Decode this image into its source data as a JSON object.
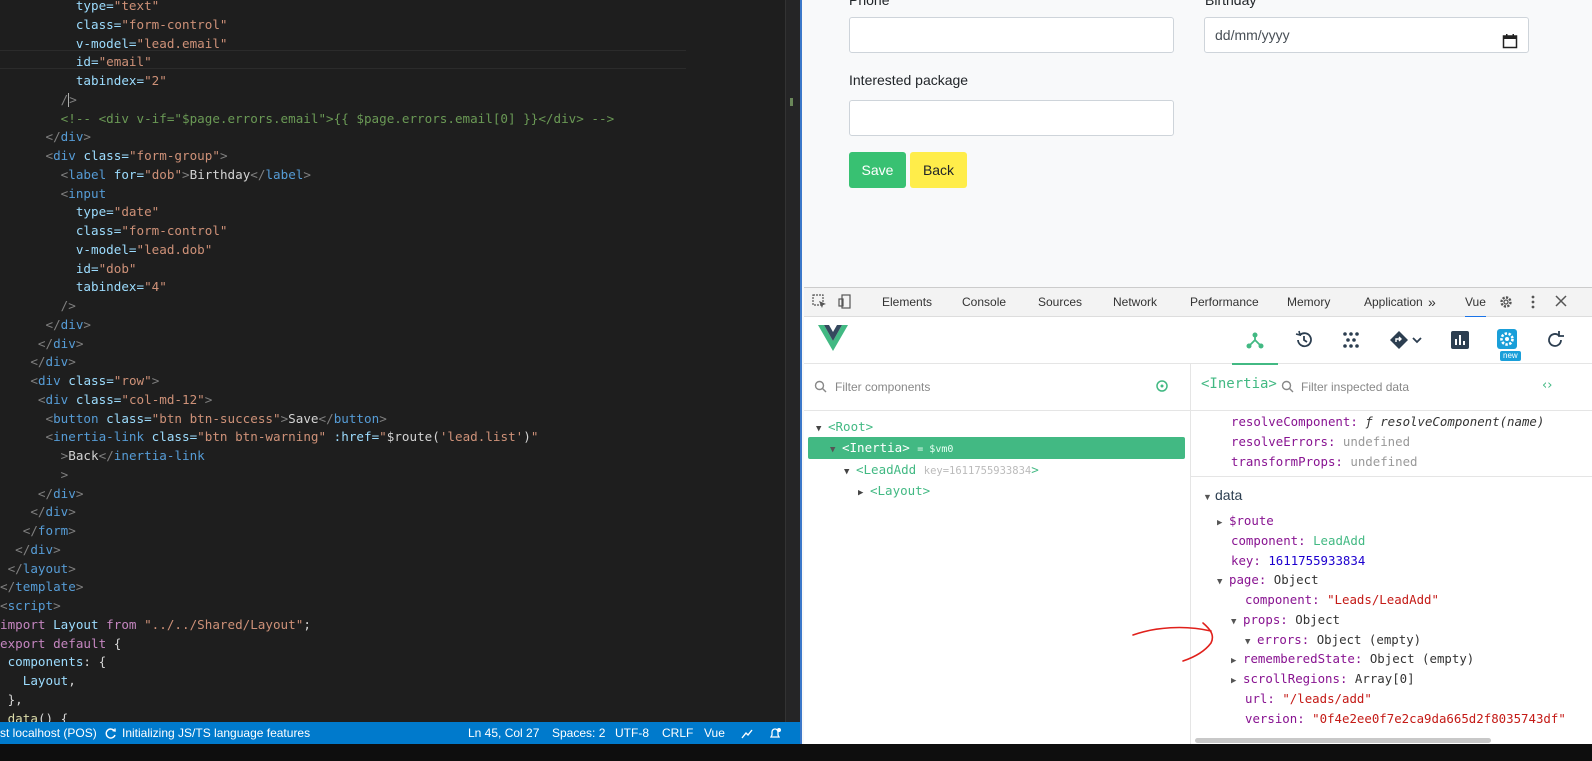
{
  "editor": {
    "lines": [
      [
        [
          "          ",
          "t-txt"
        ],
        [
          "type=",
          "t-attr"
        ],
        [
          "\"text\"",
          "t-str"
        ]
      ],
      [
        [
          "          ",
          "t-txt"
        ],
        [
          "class=",
          "t-attr"
        ],
        [
          "\"form-control\"",
          "t-str"
        ]
      ],
      [
        [
          "          ",
          "t-txt"
        ],
        [
          "v-model=",
          "t-attr"
        ],
        [
          "\"lead.email\"",
          "t-str"
        ]
      ],
      [
        [
          "          ",
          "t-txt"
        ],
        [
          "id=",
          "t-attr"
        ],
        [
          "\"email\"",
          "t-str"
        ]
      ],
      [
        [
          "          ",
          "t-txt"
        ],
        [
          "tabindex=",
          "t-attr"
        ],
        [
          "\"2\"",
          "t-str"
        ]
      ],
      [
        [
          "        ",
          "t-txt"
        ],
        [
          "/",
          "t-br"
        ],
        [
          "CURSOR",
          ""
        ],
        [
          ">",
          "t-br"
        ]
      ],
      [
        [
          "        ",
          "t-txt"
        ],
        [
          "<!-- <div v-if=\"$page.errors.email\">{{ $page.errors.email[0] }}</div> -->",
          "t-cmt"
        ]
      ],
      [
        [
          "      ",
          "t-txt"
        ],
        [
          "</",
          "t-br"
        ],
        [
          "div",
          "t-tag"
        ],
        [
          ">",
          "t-br"
        ]
      ],
      [
        [
          "      ",
          "t-txt"
        ],
        [
          "<",
          "t-br"
        ],
        [
          "div ",
          "t-tag"
        ],
        [
          "class=",
          "t-attr"
        ],
        [
          "\"form-group\"",
          "t-str"
        ],
        [
          ">",
          "t-br"
        ]
      ],
      [
        [
          "        ",
          "t-txt"
        ],
        [
          "<",
          "t-br"
        ],
        [
          "label ",
          "t-tag"
        ],
        [
          "for=",
          "t-attr"
        ],
        [
          "\"dob\"",
          "t-str"
        ],
        [
          ">",
          "t-br"
        ],
        [
          "Birthday",
          "t-txt"
        ],
        [
          "</",
          "t-br"
        ],
        [
          "label",
          "t-tag"
        ],
        [
          ">",
          "t-br"
        ]
      ],
      [
        [
          "        ",
          "t-txt"
        ],
        [
          "<",
          "t-br"
        ],
        [
          "input",
          "t-tag"
        ]
      ],
      [
        [
          "          ",
          "t-txt"
        ],
        [
          "type=",
          "t-attr"
        ],
        [
          "\"date\"",
          "t-str"
        ]
      ],
      [
        [
          "          ",
          "t-txt"
        ],
        [
          "class=",
          "t-attr"
        ],
        [
          "\"form-control\"",
          "t-str"
        ]
      ],
      [
        [
          "          ",
          "t-txt"
        ],
        [
          "v-model=",
          "t-attr"
        ],
        [
          "\"lead.dob\"",
          "t-str"
        ]
      ],
      [
        [
          "          ",
          "t-txt"
        ],
        [
          "id=",
          "t-attr"
        ],
        [
          "\"dob\"",
          "t-str"
        ]
      ],
      [
        [
          "          ",
          "t-txt"
        ],
        [
          "tabindex=",
          "t-attr"
        ],
        [
          "\"4\"",
          "t-str"
        ]
      ],
      [
        [
          "        ",
          "t-txt"
        ],
        [
          "/>",
          "t-br"
        ]
      ],
      [
        [
          "      ",
          "t-txt"
        ],
        [
          "</",
          "t-br"
        ],
        [
          "div",
          "t-tag"
        ],
        [
          ">",
          "t-br"
        ]
      ],
      [
        [
          "     ",
          "t-txt"
        ],
        [
          "</",
          "t-br"
        ],
        [
          "div",
          "t-tag"
        ],
        [
          ">",
          "t-br"
        ]
      ],
      [
        [
          "    ",
          "t-txt"
        ],
        [
          "</",
          "t-br"
        ],
        [
          "div",
          "t-tag"
        ],
        [
          ">",
          "t-br"
        ]
      ],
      [
        [
          "    ",
          "t-txt"
        ],
        [
          "<",
          "t-br"
        ],
        [
          "div ",
          "t-tag"
        ],
        [
          "class=",
          "t-attr"
        ],
        [
          "\"row\"",
          "t-str"
        ],
        [
          ">",
          "t-br"
        ]
      ],
      [
        [
          "     ",
          "t-txt"
        ],
        [
          "<",
          "t-br"
        ],
        [
          "div ",
          "t-tag"
        ],
        [
          "class=",
          "t-attr"
        ],
        [
          "\"col-md-12\"",
          "t-str"
        ],
        [
          ">",
          "t-br"
        ]
      ],
      [
        [
          "      ",
          "t-txt"
        ],
        [
          "<",
          "t-br"
        ],
        [
          "button ",
          "t-tag"
        ],
        [
          "class=",
          "t-attr"
        ],
        [
          "\"btn btn-success\"",
          "t-str"
        ],
        [
          ">",
          "t-br"
        ],
        [
          "Save",
          "t-txt"
        ],
        [
          "</",
          "t-br"
        ],
        [
          "button",
          "t-tag"
        ],
        [
          ">",
          "t-br"
        ]
      ],
      [
        [
          "      ",
          "t-txt"
        ],
        [
          "<",
          "t-br"
        ],
        [
          "inertia-link ",
          "t-tag"
        ],
        [
          "class=",
          "t-attr"
        ],
        [
          "\"btn btn-warning\"",
          "t-str"
        ],
        [
          " :href=",
          "t-attr"
        ],
        [
          "\"",
          "t-str"
        ],
        [
          "$route(",
          "t-txt"
        ],
        [
          "'lead.list'",
          "t-str"
        ],
        [
          ")",
          "t-txt"
        ],
        [
          "\"",
          "t-str"
        ]
      ],
      [
        [
          "        ",
          "t-txt"
        ],
        [
          ">",
          "t-br"
        ],
        [
          "Back",
          "t-txt"
        ],
        [
          "</",
          "t-br"
        ],
        [
          "inertia-link",
          "t-tag"
        ]
      ],
      [
        [
          "        ",
          "t-txt"
        ],
        [
          ">",
          "t-br"
        ]
      ],
      [
        [
          "     ",
          "t-txt"
        ],
        [
          "</",
          "t-br"
        ],
        [
          "div",
          "t-tag"
        ],
        [
          ">",
          "t-br"
        ]
      ],
      [
        [
          "    ",
          "t-txt"
        ],
        [
          "</",
          "t-br"
        ],
        [
          "div",
          "t-tag"
        ],
        [
          ">",
          "t-br"
        ]
      ],
      [
        [
          "   ",
          "t-txt"
        ],
        [
          "</",
          "t-br"
        ],
        [
          "form",
          "t-tag"
        ],
        [
          ">",
          "t-br"
        ]
      ],
      [
        [
          "  ",
          "t-txt"
        ],
        [
          "</",
          "t-br"
        ],
        [
          "div",
          "t-tag"
        ],
        [
          ">",
          "t-br"
        ]
      ],
      [
        [
          " ",
          "t-txt"
        ],
        [
          "</",
          "t-br"
        ],
        [
          "layout",
          "t-tag"
        ],
        [
          ">",
          "t-br"
        ]
      ],
      [
        [
          "</",
          "t-br"
        ],
        [
          "template",
          "t-tag"
        ],
        [
          ">",
          "t-br"
        ]
      ],
      [
        [
          "<",
          "t-br"
        ],
        [
          "script",
          "t-tag"
        ],
        [
          ">",
          "t-br"
        ]
      ],
      [
        [
          "import ",
          "t-kw"
        ],
        [
          "Layout ",
          "t-attr"
        ],
        [
          "from ",
          "t-kw"
        ],
        [
          "\"../../Shared/Layout\"",
          "t-str"
        ],
        [
          ";",
          "t-txt"
        ]
      ],
      [
        [
          "export default ",
          "t-kw"
        ],
        [
          "{",
          "t-txt"
        ]
      ],
      [
        [
          " ",
          "t-txt"
        ],
        [
          "components",
          "t-attr"
        ],
        [
          ": {",
          "t-txt"
        ]
      ],
      [
        [
          "   ",
          "t-txt"
        ],
        [
          "Layout",
          "t-attr"
        ],
        [
          ",",
          "t-txt"
        ]
      ],
      [
        [
          " ",
          "t-txt"
        ],
        [
          "},",
          "t-txt"
        ]
      ],
      [
        [
          " ",
          "t-txt"
        ],
        [
          "data",
          "t-fn"
        ],
        [
          "() {",
          "t-txt"
        ]
      ]
    ]
  },
  "statusbar": {
    "remote": "st localhost (POS)",
    "lang_init": "Initializing JS/TS language features",
    "position": "Ln 45, Col 27",
    "spaces": "Spaces: 2",
    "encoding": "UTF-8",
    "eol": "CRLF",
    "language": "Vue"
  },
  "form": {
    "phone_label": "Phone",
    "birthday_label": "Birthday",
    "birthday_placeholder": "dd/mm/yyyy",
    "package_label": "Interested package",
    "save_label": "Save",
    "back_label": "Back",
    "save_color": "#38c172",
    "back_color": "#ffed4a"
  },
  "devtools": {
    "tabs": [
      "Elements",
      "Console",
      "Sources",
      "Network",
      "Performance",
      "Memory",
      "Application",
      "Vue"
    ],
    "active_tab": "Vue",
    "more": "»",
    "filter_components": "Filter components",
    "inspected_name": "<Inertia>",
    "filter_inspected": "Filter inspected data",
    "new_badge": "new",
    "vue_green": "#42b983",
    "tree": {
      "root": "<Root>",
      "inertia": "<Inertia>",
      "inertia_vm": "= $vm0",
      "leadadd": "<LeadAdd",
      "leadadd_key": "key=1611755933834",
      "leadadd_close": ">",
      "layout": "<Layout>"
    },
    "props": {
      "resolve_component_key": "resolveComponent:",
      "resolve_component_val": "ƒ resolveComponent(name)",
      "resolve_errors_key": "resolveErrors:",
      "resolve_errors_val": "undefined",
      "transform_props_key": "transformProps:",
      "transform_props_val": "undefined",
      "data_section": "data",
      "route_key": "$route",
      "component_key": "component:",
      "component_val": "LeadAdd",
      "key_key": "key:",
      "key_val": "1611755933834",
      "page_key": "page:",
      "page_val": "Object",
      "page_component_key": "component:",
      "page_component_val": "\"Leads/LeadAdd\"",
      "props_key": "props:",
      "props_val": "Object",
      "errors_key": "errors:",
      "errors_val": "Object (empty)",
      "remembered_key": "rememberedState:",
      "remembered_val": "Object (empty)",
      "scroll_key": "scrollRegions:",
      "scroll_val": "Array[0]",
      "url_key": "url:",
      "url_val": "\"/leads/add\"",
      "version_key": "version:",
      "version_val": "\"0f4e2ee0f7e2ca9da665d2f8035743df\""
    },
    "annotation_color": "#e0201b"
  }
}
